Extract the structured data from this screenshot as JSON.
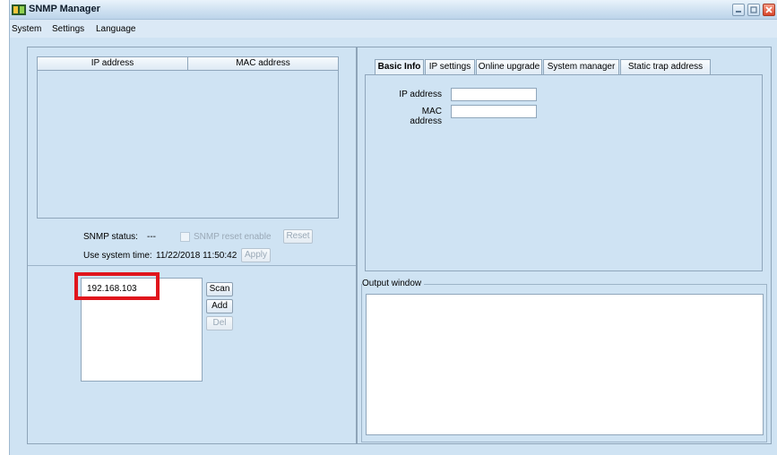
{
  "window": {
    "title": "SNMP Manager",
    "icon": "snmp-app-icon"
  },
  "window_controls": [
    "minimize-icon",
    "maximize-icon",
    "close-icon"
  ],
  "menu": [
    "System",
    "Settings",
    "Language"
  ],
  "device_table": {
    "headers": {
      "ip": "IP address",
      "mac": "MAC address"
    },
    "rows": []
  },
  "snmp": {
    "status_label": "SNMP status:",
    "status_value": "---",
    "reset_enable_label": "SNMP reset enable",
    "reset_button": "Reset"
  },
  "system_time": {
    "label": "Use system time:",
    "value": "11/22/2018 11:50:42",
    "apply_button": "Apply"
  },
  "ip_list": {
    "entries": [
      "192.168.103"
    ]
  },
  "list_buttons": {
    "scan": "Scan",
    "add": "Add",
    "del": "Del"
  },
  "tabs": [
    "Basic Info",
    "IP settings",
    "Online upgrade",
    "System manager",
    "Static trap address"
  ],
  "active_tab": "Basic Info",
  "basic_info": {
    "ip_label": "IP address",
    "ip_value": "",
    "mac_label": "MAC address",
    "mac_value": ""
  },
  "output": {
    "legend": "Output window",
    "text": ""
  },
  "colors": {
    "background": "#cfe3f3",
    "highlight_box": "#e0151c"
  }
}
